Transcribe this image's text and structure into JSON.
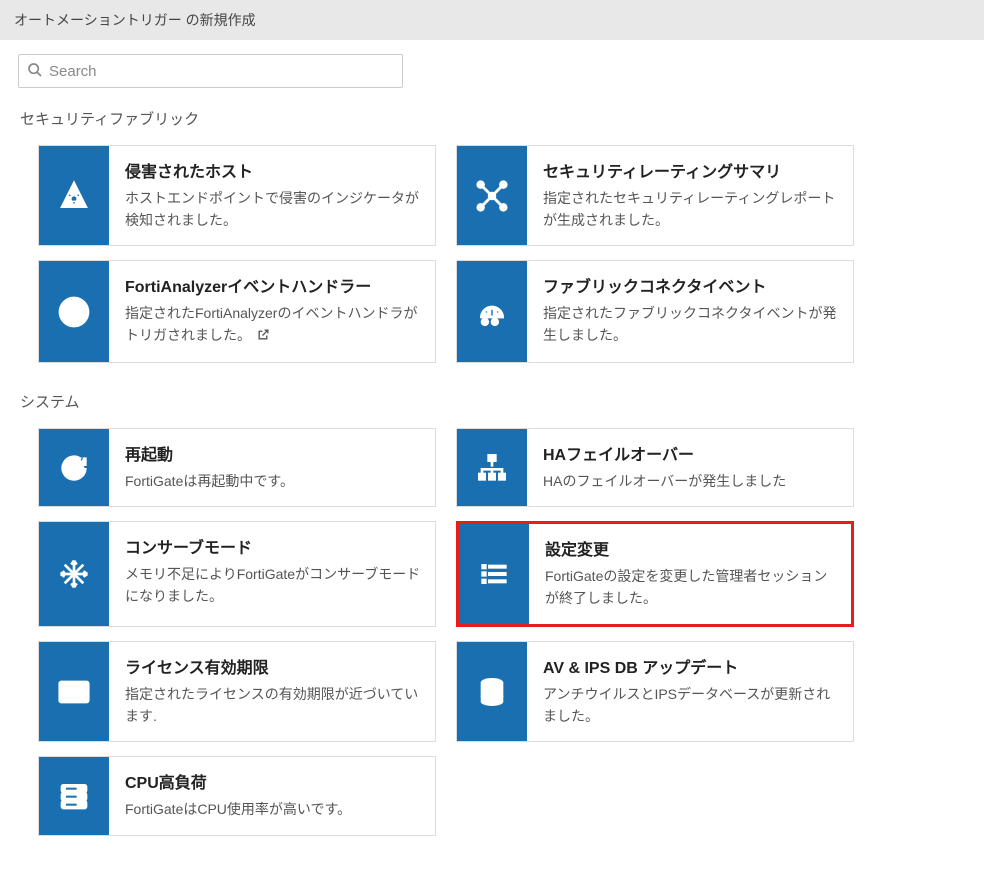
{
  "header": {
    "title": "オートメーショントリガー の新規作成"
  },
  "search": {
    "placeholder": "Search"
  },
  "sections": {
    "security_fabric": {
      "title": "セキュリティファブリック",
      "cards": [
        {
          "title": "侵害されたホスト",
          "desc": "ホストエンドポイントで侵害のインジケータが検知されました。",
          "icon": "biohazard"
        },
        {
          "title": "セキュリティレーティングサマリ",
          "desc": "指定されたセキュリティレーティングレポートが生成されました。",
          "icon": "network-sparkle"
        },
        {
          "title": "FortiAnalyzerイベントハンドラー",
          "desc": "指定されたFortiAnalyzerのイベントハンドラがトリガされました。",
          "icon": "pie-chart",
          "has_link_icon": true
        },
        {
          "title": "ファブリックコネクタイベント",
          "desc": "指定されたファブリックコネクタイベントが発生しました。",
          "icon": "gauge"
        }
      ]
    },
    "system": {
      "title": "システム",
      "cards": [
        {
          "title": "再起動",
          "desc": "FortiGateは再起動中です。",
          "icon": "reload"
        },
        {
          "title": "HAフェイルオーバー",
          "desc": "HAのフェイルオーバーが発生しました",
          "icon": "sitemap"
        },
        {
          "title": "コンサーブモード",
          "desc": "メモリ不足によりFortiGateがコンサーブモードになりました。",
          "icon": "snowflake"
        },
        {
          "title": "設定変更",
          "desc": "FortiGateの設定を変更した管理者セッションが終了しました。",
          "icon": "list",
          "highlighted": true
        },
        {
          "title": "ライセンス有効期限",
          "desc": "指定されたライセンスの有効期限が近づいています.",
          "icon": "id-card"
        },
        {
          "title": "AV & IPS DB アップデート",
          "desc": "アンチウイルスとIPSデータベースが更新されました。",
          "icon": "database"
        },
        {
          "title": "CPU高負荷",
          "desc": "FortiGateはCPU使用率が高いです。",
          "icon": "server"
        }
      ]
    }
  }
}
